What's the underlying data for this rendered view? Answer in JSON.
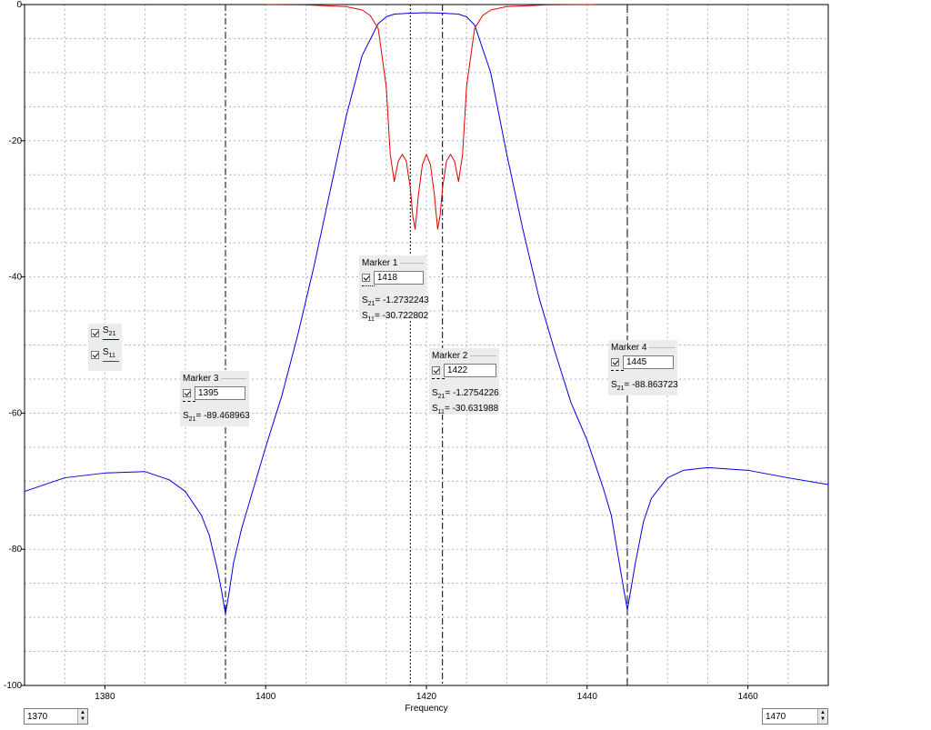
{
  "chart_data": {
    "type": "line",
    "xlabel": "Frequency",
    "ylabel": "",
    "xlim": [
      1370,
      1470
    ],
    "ylim": [
      -100,
      0
    ],
    "x_ticks": [
      1380,
      1400,
      1420,
      1440,
      1460
    ],
    "y_ticks": [
      0,
      -20,
      -40,
      -60,
      -80,
      -100
    ],
    "grid": true,
    "series": [
      {
        "name": "S21",
        "color": "#0000e0",
        "x": [
          1370,
          1375,
          1380,
          1385,
          1388,
          1390,
          1392,
          1393,
          1394,
          1394.5,
          1395,
          1395.5,
          1396,
          1397,
          1398,
          1400,
          1402,
          1404,
          1406,
          1408,
          1410,
          1412,
          1414,
          1415,
          1416,
          1418,
          1420,
          1422,
          1424,
          1425,
          1426,
          1428,
          1430,
          1432,
          1434,
          1436,
          1438,
          1440,
          1442,
          1443,
          1444,
          1444.5,
          1445,
          1445.5,
          1446,
          1447,
          1448,
          1450,
          1452,
          1455,
          1460,
          1465,
          1470
        ],
        "y": [
          -71.5,
          -69.5,
          -68.8,
          -68.6,
          -69.8,
          -71.5,
          -75,
          -78,
          -83,
          -86,
          -89.5,
          -86,
          -82,
          -77,
          -73,
          -65,
          -57.5,
          -48.5,
          -38.5,
          -27.5,
          -16.5,
          -7.5,
          -2.8,
          -1.8,
          -1.4,
          -1.27,
          -1.2,
          -1.27,
          -1.4,
          -1.8,
          -3,
          -10,
          -22,
          -33,
          -43,
          -51,
          -58.5,
          -64,
          -71,
          -75,
          -82,
          -85.5,
          -88.9,
          -85.5,
          -82,
          -76,
          -72.5,
          -69.5,
          -68.4,
          -68,
          -68.4,
          -69.5,
          -70.5
        ]
      },
      {
        "name": "S11",
        "color": "#e00000",
        "x": [
          1400,
          1405,
          1410,
          1412,
          1413,
          1414,
          1415,
          1415.5,
          1416,
          1416.5,
          1417,
          1417.5,
          1418,
          1418.3,
          1418.6,
          1419,
          1419.5,
          1420,
          1420.5,
          1421,
          1421.4,
          1421.7,
          1422,
          1422.5,
          1423,
          1423.5,
          1424,
          1424.5,
          1425,
          1426,
          1427,
          1428,
          1430,
          1435,
          1441
        ],
        "y": [
          -0.01,
          -0.05,
          -0.3,
          -0.8,
          -1.6,
          -3.5,
          -12,
          -22,
          -26,
          -23,
          -22,
          -23,
          -27,
          -31,
          -33,
          -28,
          -23.5,
          -22,
          -23.5,
          -28,
          -33,
          -31,
          -27,
          -23,
          -22,
          -23,
          -26,
          -22,
          -12,
          -3.5,
          -1.6,
          -0.8,
          -0.3,
          -0.05,
          -0.01
        ]
      }
    ],
    "markers": [
      {
        "title": "Marker 1",
        "freq": "1418",
        "x": 1418,
        "lines": [
          {
            "sym": "S",
            "sub": "21",
            "rest": "= -1.2732243"
          },
          {
            "sym": "S",
            "sub": "11",
            "rest": "= -30.722802"
          }
        ]
      },
      {
        "title": "Marker 2",
        "freq": "1422",
        "x": 1422,
        "lines": [
          {
            "sym": "S",
            "sub": "21",
            "rest": "= -1.2754226"
          },
          {
            "sym": "S",
            "sub": "11",
            "rest": "= -30.631988"
          }
        ]
      },
      {
        "title": "Marker 3",
        "freq": "1395",
        "x": 1395,
        "lines": [
          {
            "sym": "S",
            "sub": "21",
            "rest": "= -89.468963"
          }
        ]
      },
      {
        "title": "Marker 4",
        "freq": "1445",
        "x": 1445,
        "lines": [
          {
            "sym": "S",
            "sub": "21",
            "rest": "= -88.863723"
          }
        ]
      }
    ],
    "legend": [
      {
        "sym": "S",
        "sub": "21",
        "color": "#0000e0"
      },
      {
        "sym": "S",
        "sub": "11",
        "color": "#e00000"
      }
    ]
  },
  "controls": {
    "x_min": "1370",
    "x_max": "1470"
  }
}
